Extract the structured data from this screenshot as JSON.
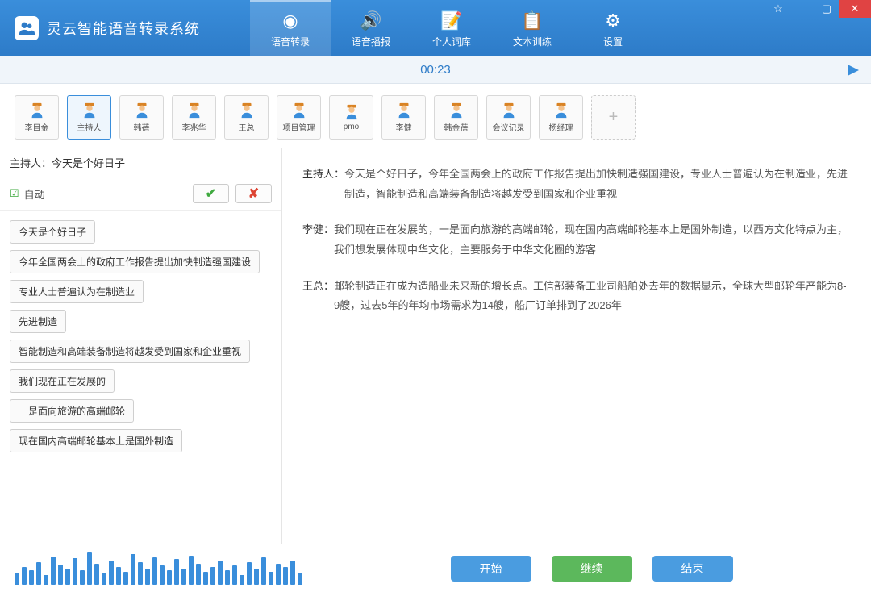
{
  "app": {
    "title": "灵云智能语音转录系统"
  },
  "nav": {
    "items": [
      {
        "label": "语音转录",
        "icon": "record"
      },
      {
        "label": "语音播报",
        "icon": "speaker"
      },
      {
        "label": "个人词库",
        "icon": "doc"
      },
      {
        "label": "文本训练",
        "icon": "table"
      },
      {
        "label": "设置",
        "icon": "gear"
      }
    ]
  },
  "timer": {
    "value": "00:23"
  },
  "speakers": [
    {
      "name": "李目金"
    },
    {
      "name": "主持人"
    },
    {
      "name": "韩蓓"
    },
    {
      "name": "李兆华"
    },
    {
      "name": "王总"
    },
    {
      "name": "项目管理"
    },
    {
      "name": "pmo"
    },
    {
      "name": "李健"
    },
    {
      "name": "韩金蓓"
    },
    {
      "name": "会议记录"
    },
    {
      "name": "杨经理"
    }
  ],
  "current_input": {
    "text": "主持人：今天是个好日子"
  },
  "auto": {
    "label": "自动"
  },
  "phrases": [
    "今天是个好日子",
    "今年全国两会上的政府工作报告提出加快制造强国建设",
    "专业人士普遍认为在制造业",
    "先进制造",
    "智能制造和高端装备制造将越发受到国家和企业重视",
    "我们现在正在发展的",
    "一是面向旅游的高端邮轮",
    "现在国内高端邮轮基本上是国外制造"
  ],
  "transcript": [
    {
      "speaker": "主持人：",
      "text": "今天是个好日子，今年全国两会上的政府工作报告提出加快制造强国建设，专业人士普遍认为在制造业，先进制造，智能制造和高端装备制造将越发受到国家和企业重视"
    },
    {
      "speaker": "李健：",
      "text": "我们现在正在发展的，一是面向旅游的高端邮轮，现在国内高端邮轮基本上是国外制造，以西方文化特点为主，我们想发展体现中华文化，主要服务于中华文化圈的游客"
    },
    {
      "speaker": "王总：",
      "text": "邮轮制造正在成为造船业未来新的增长点。工信部装备工业司船舶处去年的数据显示，全球大型邮轮年产能为8-9艘，过去5年的年均市场需求为14艘，船厂订单排到了2026年"
    }
  ],
  "waveform_heights": [
    15,
    22,
    18,
    28,
    12,
    35,
    25,
    20,
    33,
    18,
    40,
    26,
    14,
    30,
    22,
    16,
    38,
    28,
    20,
    34,
    24,
    18,
    32,
    20,
    36,
    26,
    16,
    22,
    30,
    18,
    24,
    12,
    28,
    20,
    34,
    16,
    26,
    22,
    30,
    14
  ],
  "actions": {
    "start": "开始",
    "continue": "继续",
    "end": "结束"
  }
}
